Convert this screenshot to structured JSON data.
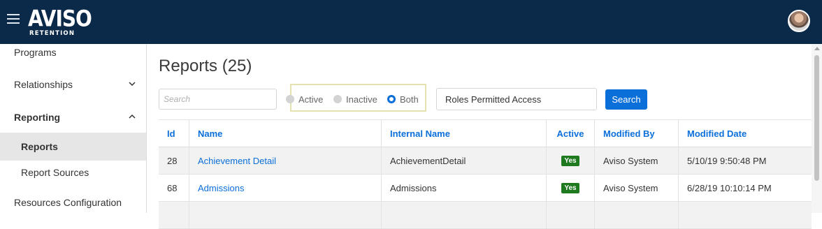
{
  "app": {
    "logo_text": "AVISO",
    "logo_sub": "RETENTION"
  },
  "sidebar": {
    "items": [
      {
        "label": "Programs"
      },
      {
        "label": "Relationships",
        "icon": "chevron-down-icon"
      },
      {
        "label": "Reporting",
        "icon": "chevron-up-icon"
      },
      {
        "label": "Reports",
        "active": true
      },
      {
        "label": "Report Sources"
      },
      {
        "label": "Resources Configuration"
      }
    ]
  },
  "main": {
    "title": "Reports (25)",
    "search_placeholder": "Search",
    "filters": [
      {
        "label": "Active",
        "checked": false
      },
      {
        "label": "Inactive",
        "checked": false
      },
      {
        "label": "Both",
        "checked": true
      }
    ],
    "secondary_filter_value": "Roles Permitted Access",
    "search_button": "Search"
  },
  "table": {
    "columns": [
      "Id",
      "Name",
      "Internal Name",
      "Active",
      "Modified By",
      "Modified Date"
    ],
    "rows": [
      {
        "id": "28",
        "name": "Achievement Detail",
        "internal": "AchievementDetail",
        "active": "Yes",
        "modified_by": "Aviso System",
        "modified_date": "5/10/19 9:50:48 PM"
      },
      {
        "id": "68",
        "name": "Admissions",
        "internal": "Admissions",
        "active": "Yes",
        "modified_by": "Aviso System",
        "modified_date": "6/28/19 10:10:14 PM"
      },
      {
        "id": "",
        "name": "",
        "internal": "",
        "active": "",
        "modified_by": "",
        "modified_date": ""
      }
    ]
  },
  "colors": {
    "topbar": "#0b2a4a",
    "accent": "#0a6fd9",
    "badge_green": "#1f7a1f",
    "highlight": "#e4e3b0"
  }
}
